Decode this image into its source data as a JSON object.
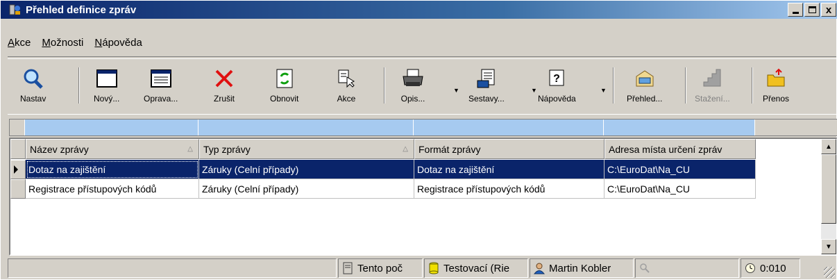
{
  "window": {
    "title": "Přehled definice zpráv",
    "min_label": "_",
    "close_label": "x"
  },
  "menu": [
    {
      "underline": "A",
      "rest": "kce"
    },
    {
      "underline": "M",
      "rest": "ožnosti"
    },
    {
      "underline": "N",
      "rest": "ápověda"
    }
  ],
  "toolbar": {
    "nastav": "Nastav",
    "novy": "Nový...",
    "oprava": "Oprava...",
    "zrusit": "Zrušit",
    "obnovit": "Obnovit",
    "akce": "Akce",
    "opis": "Opis...",
    "sestavy": "Sestavy...",
    "napoveda": "Nápověda",
    "prehled": "Přehled...",
    "stazeni": "Stažení...",
    "prenos": "Přenos"
  },
  "grid": {
    "headers": [
      "Název zprávy",
      "Typ zprávy",
      "Formát zprávy",
      "Adresa místa určení zpráv"
    ],
    "rows": [
      [
        "Dotaz na zajištění",
        "Záruky (Celní případy)",
        "Dotaz na zajištění",
        "C:\\EuroDat\\Na_CU"
      ],
      [
        "Registrace přístupových kódů",
        "Záruky (Celní případy)",
        "Registrace přístupových kódů",
        "C:\\EuroDat\\Na_CU"
      ]
    ],
    "selected_row": 0
  },
  "statusbar": {
    "computer": "Tento poč",
    "database": "Testovací (Rie",
    "user": "Martin Kobler",
    "time": "0:010"
  }
}
